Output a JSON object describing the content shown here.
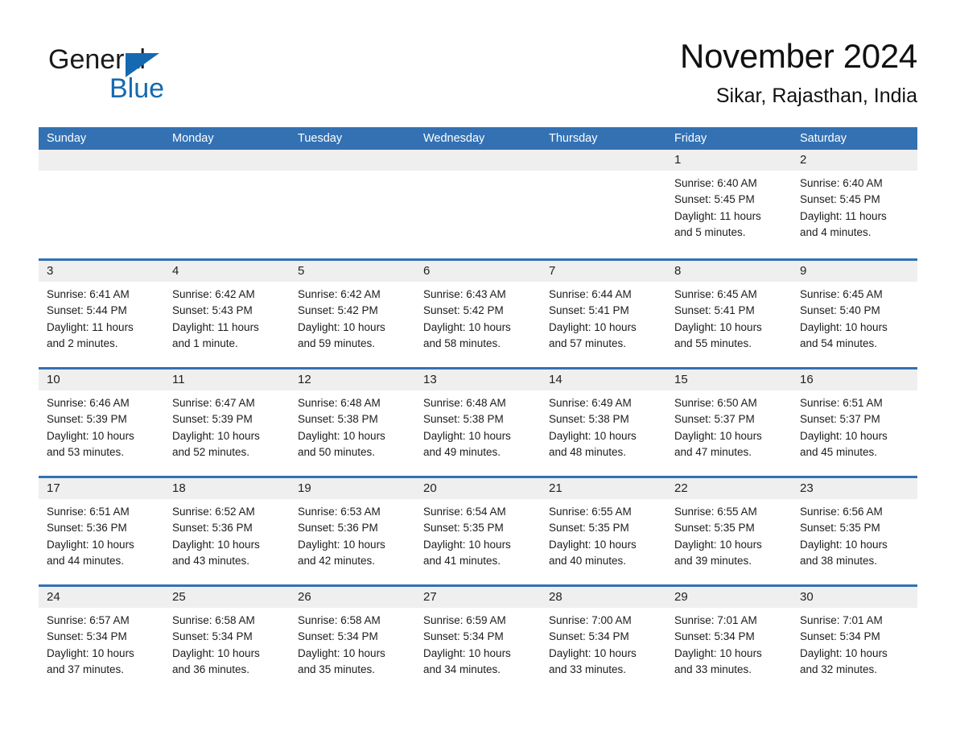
{
  "brand": {
    "name_part1": "General",
    "name_part2": "Blue",
    "triangle_color": "#1569b0",
    "text_color": "#1a1a1a"
  },
  "header": {
    "title": "November 2024",
    "subtitle": "Sikar, Rajasthan, India"
  },
  "theme": {
    "header_blue": "#3371b3",
    "day_band_gray": "#efefef",
    "row_divider_blue": "#3371b3",
    "text_color": "#1c1c1c",
    "page_background": "#ffffff"
  },
  "weekdays": [
    "Sunday",
    "Monday",
    "Tuesday",
    "Wednesday",
    "Thursday",
    "Friday",
    "Saturday"
  ],
  "labels": {
    "sunrise_prefix": "Sunrise:",
    "sunset_prefix": "Sunset:",
    "daylight_prefix": "Daylight:"
  },
  "weeks": [
    [
      {
        "day": "",
        "empty": true
      },
      {
        "day": "",
        "empty": true
      },
      {
        "day": "",
        "empty": true
      },
      {
        "day": "",
        "empty": true
      },
      {
        "day": "",
        "empty": true
      },
      {
        "day": "1",
        "sunrise": "Sunrise: 6:40 AM",
        "sunset": "Sunset: 5:45 PM",
        "daylight1": "Daylight: 11 hours",
        "daylight2": "and 5 minutes."
      },
      {
        "day": "2",
        "sunrise": "Sunrise: 6:40 AM",
        "sunset": "Sunset: 5:45 PM",
        "daylight1": "Daylight: 11 hours",
        "daylight2": "and 4 minutes."
      }
    ],
    [
      {
        "day": "3",
        "sunrise": "Sunrise: 6:41 AM",
        "sunset": "Sunset: 5:44 PM",
        "daylight1": "Daylight: 11 hours",
        "daylight2": "and 2 minutes."
      },
      {
        "day": "4",
        "sunrise": "Sunrise: 6:42 AM",
        "sunset": "Sunset: 5:43 PM",
        "daylight1": "Daylight: 11 hours",
        "daylight2": "and 1 minute."
      },
      {
        "day": "5",
        "sunrise": "Sunrise: 6:42 AM",
        "sunset": "Sunset: 5:42 PM",
        "daylight1": "Daylight: 10 hours",
        "daylight2": "and 59 minutes."
      },
      {
        "day": "6",
        "sunrise": "Sunrise: 6:43 AM",
        "sunset": "Sunset: 5:42 PM",
        "daylight1": "Daylight: 10 hours",
        "daylight2": "and 58 minutes."
      },
      {
        "day": "7",
        "sunrise": "Sunrise: 6:44 AM",
        "sunset": "Sunset: 5:41 PM",
        "daylight1": "Daylight: 10 hours",
        "daylight2": "and 57 minutes."
      },
      {
        "day": "8",
        "sunrise": "Sunrise: 6:45 AM",
        "sunset": "Sunset: 5:41 PM",
        "daylight1": "Daylight: 10 hours",
        "daylight2": "and 55 minutes."
      },
      {
        "day": "9",
        "sunrise": "Sunrise: 6:45 AM",
        "sunset": "Sunset: 5:40 PM",
        "daylight1": "Daylight: 10 hours",
        "daylight2": "and 54 minutes."
      }
    ],
    [
      {
        "day": "10",
        "sunrise": "Sunrise: 6:46 AM",
        "sunset": "Sunset: 5:39 PM",
        "daylight1": "Daylight: 10 hours",
        "daylight2": "and 53 minutes."
      },
      {
        "day": "11",
        "sunrise": "Sunrise: 6:47 AM",
        "sunset": "Sunset: 5:39 PM",
        "daylight1": "Daylight: 10 hours",
        "daylight2": "and 52 minutes."
      },
      {
        "day": "12",
        "sunrise": "Sunrise: 6:48 AM",
        "sunset": "Sunset: 5:38 PM",
        "daylight1": "Daylight: 10 hours",
        "daylight2": "and 50 minutes."
      },
      {
        "day": "13",
        "sunrise": "Sunrise: 6:48 AM",
        "sunset": "Sunset: 5:38 PM",
        "daylight1": "Daylight: 10 hours",
        "daylight2": "and 49 minutes."
      },
      {
        "day": "14",
        "sunrise": "Sunrise: 6:49 AM",
        "sunset": "Sunset: 5:38 PM",
        "daylight1": "Daylight: 10 hours",
        "daylight2": "and 48 minutes."
      },
      {
        "day": "15",
        "sunrise": "Sunrise: 6:50 AM",
        "sunset": "Sunset: 5:37 PM",
        "daylight1": "Daylight: 10 hours",
        "daylight2": "and 47 minutes."
      },
      {
        "day": "16",
        "sunrise": "Sunrise: 6:51 AM",
        "sunset": "Sunset: 5:37 PM",
        "daylight1": "Daylight: 10 hours",
        "daylight2": "and 45 minutes."
      }
    ],
    [
      {
        "day": "17",
        "sunrise": "Sunrise: 6:51 AM",
        "sunset": "Sunset: 5:36 PM",
        "daylight1": "Daylight: 10 hours",
        "daylight2": "and 44 minutes."
      },
      {
        "day": "18",
        "sunrise": "Sunrise: 6:52 AM",
        "sunset": "Sunset: 5:36 PM",
        "daylight1": "Daylight: 10 hours",
        "daylight2": "and 43 minutes."
      },
      {
        "day": "19",
        "sunrise": "Sunrise: 6:53 AM",
        "sunset": "Sunset: 5:36 PM",
        "daylight1": "Daylight: 10 hours",
        "daylight2": "and 42 minutes."
      },
      {
        "day": "20",
        "sunrise": "Sunrise: 6:54 AM",
        "sunset": "Sunset: 5:35 PM",
        "daylight1": "Daylight: 10 hours",
        "daylight2": "and 41 minutes."
      },
      {
        "day": "21",
        "sunrise": "Sunrise: 6:55 AM",
        "sunset": "Sunset: 5:35 PM",
        "daylight1": "Daylight: 10 hours",
        "daylight2": "and 40 minutes."
      },
      {
        "day": "22",
        "sunrise": "Sunrise: 6:55 AM",
        "sunset": "Sunset: 5:35 PM",
        "daylight1": "Daylight: 10 hours",
        "daylight2": "and 39 minutes."
      },
      {
        "day": "23",
        "sunrise": "Sunrise: 6:56 AM",
        "sunset": "Sunset: 5:35 PM",
        "daylight1": "Daylight: 10 hours",
        "daylight2": "and 38 minutes."
      }
    ],
    [
      {
        "day": "24",
        "sunrise": "Sunrise: 6:57 AM",
        "sunset": "Sunset: 5:34 PM",
        "daylight1": "Daylight: 10 hours",
        "daylight2": "and 37 minutes."
      },
      {
        "day": "25",
        "sunrise": "Sunrise: 6:58 AM",
        "sunset": "Sunset: 5:34 PM",
        "daylight1": "Daylight: 10 hours",
        "daylight2": "and 36 minutes."
      },
      {
        "day": "26",
        "sunrise": "Sunrise: 6:58 AM",
        "sunset": "Sunset: 5:34 PM",
        "daylight1": "Daylight: 10 hours",
        "daylight2": "and 35 minutes."
      },
      {
        "day": "27",
        "sunrise": "Sunrise: 6:59 AM",
        "sunset": "Sunset: 5:34 PM",
        "daylight1": "Daylight: 10 hours",
        "daylight2": "and 34 minutes."
      },
      {
        "day": "28",
        "sunrise": "Sunrise: 7:00 AM",
        "sunset": "Sunset: 5:34 PM",
        "daylight1": "Daylight: 10 hours",
        "daylight2": "and 33 minutes."
      },
      {
        "day": "29",
        "sunrise": "Sunrise: 7:01 AM",
        "sunset": "Sunset: 5:34 PM",
        "daylight1": "Daylight: 10 hours",
        "daylight2": "and 33 minutes."
      },
      {
        "day": "30",
        "sunrise": "Sunrise: 7:01 AM",
        "sunset": "Sunset: 5:34 PM",
        "daylight1": "Daylight: 10 hours",
        "daylight2": "and 32 minutes."
      }
    ]
  ]
}
